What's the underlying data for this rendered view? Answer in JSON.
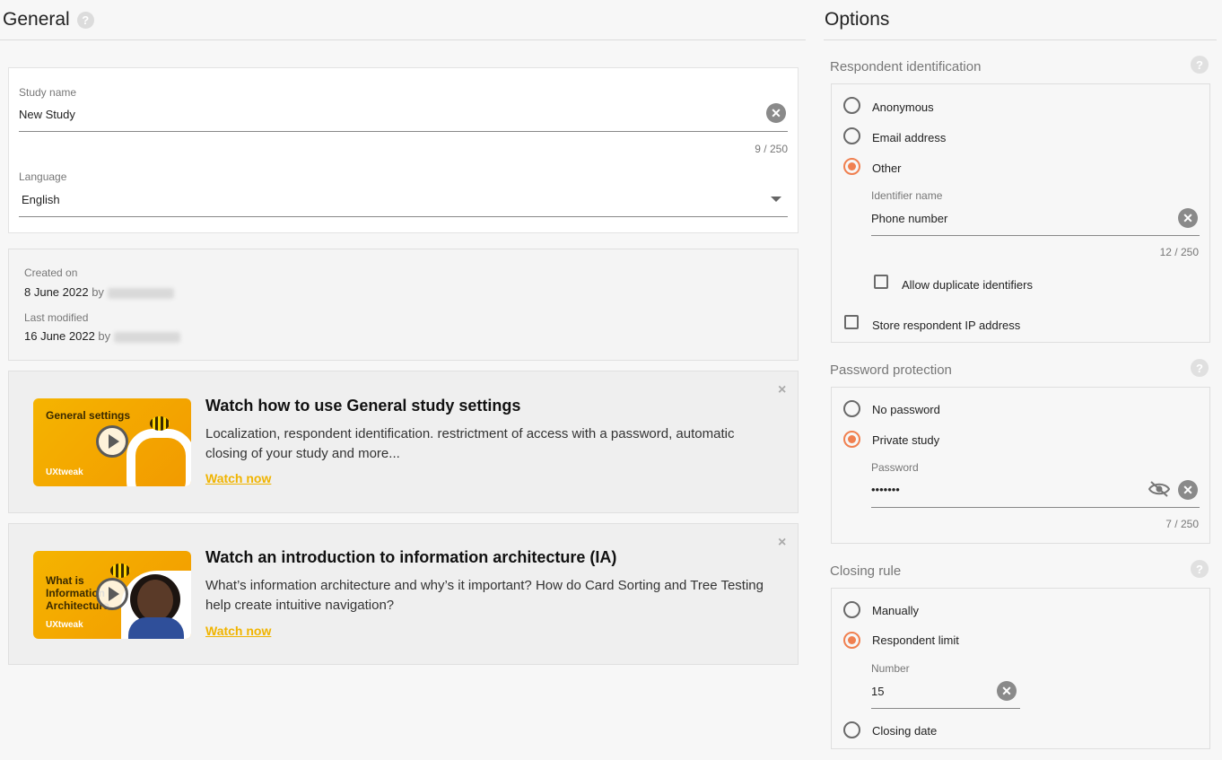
{
  "general": {
    "title": "General",
    "help": "?",
    "study_name": {
      "label": "Study name",
      "value": "New Study",
      "counter": "9 / 250"
    },
    "language": {
      "label": "Language",
      "value": "English"
    },
    "created": {
      "label": "Created on",
      "value": "8 June 2022",
      "by": "by"
    },
    "modified": {
      "label": "Last modified",
      "value": "16 June 2022",
      "by": "by"
    },
    "videos": [
      {
        "thumb_title": "General settings",
        "brand": "UXtweak",
        "title": "Watch how to use General study settings",
        "desc": "Localization, respondent identification. restrictment of access with a password, automatic closing of your study and more...",
        "link": "Watch now"
      },
      {
        "thumb_title": "What is Information Architecture",
        "brand": "UXtweak",
        "title": "Watch an introduction to information architecture (IA)",
        "desc": "What’s information architecture and why’s it important? How do Card Sorting and Tree Testing help create intuitive navigation?",
        "link": "Watch now"
      }
    ],
    "close_glyph": "×"
  },
  "options": {
    "title": "Options",
    "respondent": {
      "title": "Respondent identification",
      "anonymous": "Anonymous",
      "email": "Email address",
      "other": "Other",
      "identifier_label": "Identifier name",
      "identifier_value": "Phone number",
      "identifier_counter": "12 / 250",
      "allow_duplicates": "Allow duplicate identifiers",
      "store_ip": "Store respondent IP address"
    },
    "password": {
      "title": "Password protection",
      "none": "No password",
      "private": "Private study",
      "pw_label": "Password",
      "pw_value": "•••••••",
      "pw_counter": "7 / 250"
    },
    "closing": {
      "title": "Closing rule",
      "manually": "Manually",
      "limit": "Respondent limit",
      "number_label": "Number",
      "number_value": "15",
      "date": "Closing date"
    }
  },
  "colors": {
    "accent": "#f08050",
    "link": "#f0b400"
  },
  "icons": {
    "clear": "clear-icon",
    "help": "help-icon",
    "eye": "eye-off-icon",
    "play": "play-icon"
  }
}
